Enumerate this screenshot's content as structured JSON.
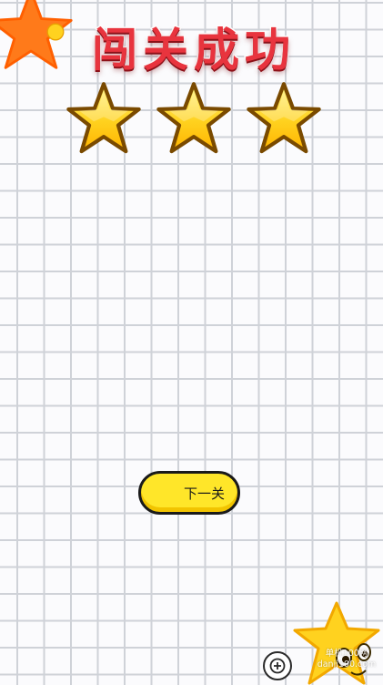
{
  "level_complete": {
    "title": "闯关成功",
    "stars_earned": 3,
    "stars_total": 3
  },
  "buttons": {
    "next_label": "下一关"
  },
  "icons": {
    "corner": "star-icon",
    "rating": "star-icon",
    "mascot": "star-mascot-icon",
    "zoom": "zoom-in-icon"
  },
  "watermark": {
    "line1": "单机100网",
    "line2": "danji100.com"
  },
  "colors": {
    "title": "#e8343e",
    "star": "#ffd21f",
    "button": "#ffe629",
    "corner_star": "#ff7a1a",
    "grid": "#cfd2d8"
  }
}
